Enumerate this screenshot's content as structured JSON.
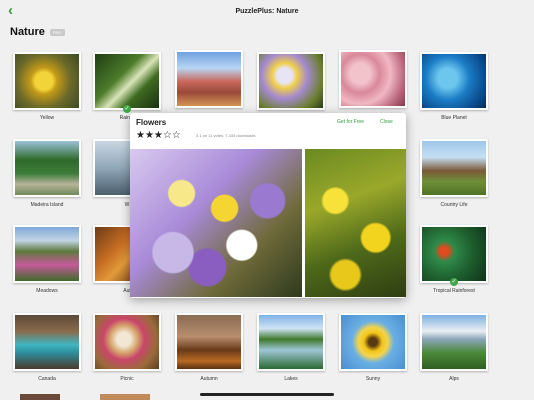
{
  "app": {
    "title": "PuzzlePlus: Nature"
  },
  "heading": {
    "title": "Nature",
    "badge": "PRO"
  },
  "tiles": [
    {
      "label": "Yellow"
    },
    {
      "label": "Rain F"
    },
    {
      "label": ""
    },
    {
      "label": ""
    },
    {
      "label": ""
    },
    {
      "label": "Blue Planet"
    },
    {
      "label": "Madeira Island"
    },
    {
      "label": "W"
    },
    {
      "label": "Country Life"
    },
    {
      "label": "Meadows"
    },
    {
      "label": "Aut"
    },
    {
      "label": "Tropical Rainforest"
    },
    {
      "label": "Canada"
    },
    {
      "label": "Picnic"
    },
    {
      "label": "Autumn"
    },
    {
      "label": "Lakes"
    },
    {
      "label": "Sunny"
    },
    {
      "label": "Alps"
    }
  ],
  "popup": {
    "title": "Flowers",
    "stars": "★★★☆☆",
    "votes": "3.1 on 11 votes, 7,434 downloads",
    "get_button": "Get for Free",
    "close_button": "Close"
  },
  "icons": {
    "back": "chevron-left-icon",
    "check": "checkmark-icon",
    "star": "star-icon"
  },
  "colors": {
    "accent": "#2f9e3a",
    "background": "#f0f0f0",
    "check": "#41a84a"
  }
}
